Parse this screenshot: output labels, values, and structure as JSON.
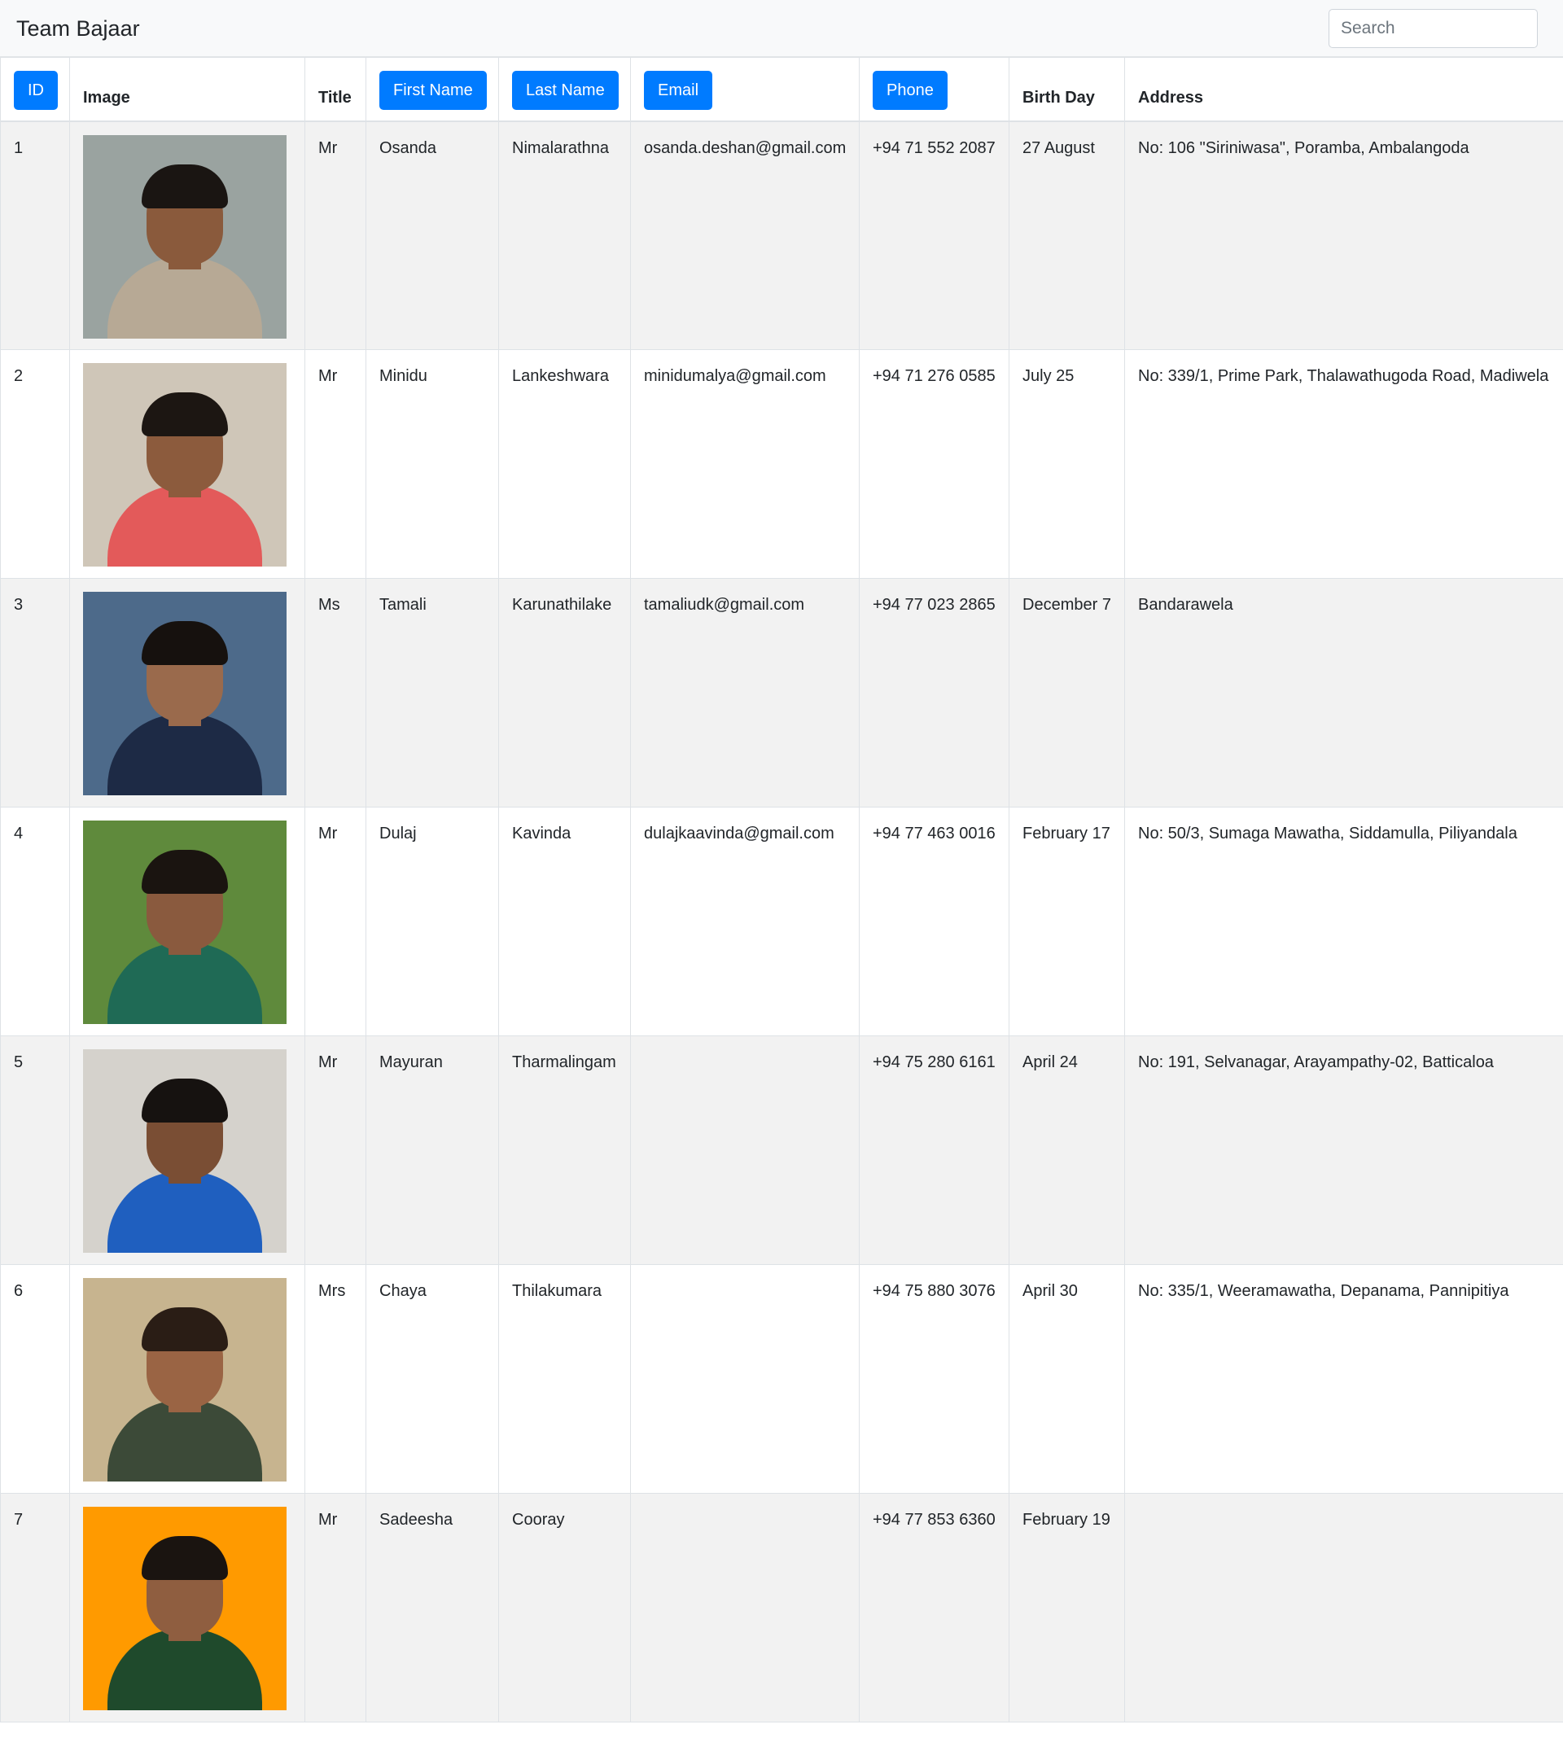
{
  "navbar": {
    "brand": "Team Bajaar",
    "search_placeholder": "Search"
  },
  "table": {
    "headers": {
      "id": "ID",
      "image": "Image",
      "title": "Title",
      "first_name": "First Name",
      "last_name": "Last Name",
      "email": "Email",
      "phone": "Phone",
      "birth_day": "Birth Day",
      "address": "Address"
    },
    "rows": [
      {
        "id": "1",
        "title": "Mr",
        "first_name": "Osanda",
        "last_name": "Nimalarathna",
        "email": "osanda.deshan@gmail.com",
        "phone": "+94 71 552 2087",
        "birth_day": "27 August",
        "address": "No: 106 \"Siriniwasa\", Poramba, Ambalangoda"
      },
      {
        "id": "2",
        "title": "Mr",
        "first_name": "Minidu",
        "last_name": "Lankeshwara",
        "email": "minidumalya@gmail.com",
        "phone": "+94 71 276 0585",
        "birth_day": "July 25",
        "address": "No: 339/1, Prime Park, Thalawathugoda Road, Madiwela"
      },
      {
        "id": "3",
        "title": "Ms",
        "first_name": "Tamali",
        "last_name": "Karunathilake",
        "email": "tamaliudk@gmail.com",
        "phone": "+94 77 023 2865",
        "birth_day": "December 7",
        "address": "Bandarawela"
      },
      {
        "id": "4",
        "title": "Mr",
        "first_name": "Dulaj",
        "last_name": "Kavinda",
        "email": "dulajkaavinda@gmail.com",
        "phone": "+94 77 463 0016",
        "birth_day": "February 17",
        "address": "No: 50/3, Sumaga Mawatha, Siddamulla, Piliyandala"
      },
      {
        "id": "5",
        "title": "Mr",
        "first_name": "Mayuran",
        "last_name": "Tharmalingam",
        "email": "",
        "phone": "+94 75 280 6161",
        "birth_day": "April 24",
        "address": "No: 191, Selvanagar, Arayampathy-02, Batticaloa"
      },
      {
        "id": "6",
        "title": "Mrs",
        "first_name": "Chaya",
        "last_name": "Thilakumara",
        "email": "",
        "phone": "+94 75 880 3076",
        "birth_day": "April 30",
        "address": "No: 335/1, Weeramawatha, Depanama, Pannipitiya"
      },
      {
        "id": "7",
        "title": "Mr",
        "first_name": "Sadeesha",
        "last_name": "Cooray",
        "email": "",
        "phone": "+94 77 853 6360",
        "birth_day": "February 19",
        "address": ""
      }
    ]
  },
  "photos": [
    {
      "bg": "#9aa3a0",
      "shirt": "#b7a995",
      "skin": "#8a5a3c",
      "hair": "#1a1512"
    },
    {
      "bg": "#cfc6b8",
      "shirt": "#e35a5a",
      "skin": "#8c5b3d",
      "hair": "#1c1612"
    },
    {
      "bg": "#4d6a8a",
      "shirt": "#1d2a45",
      "skin": "#9a6a4c",
      "hair": "#16110e"
    },
    {
      "bg": "#5f8a3c",
      "shirt": "#1f6a55",
      "skin": "#8a5a3e",
      "hair": "#1a1410"
    },
    {
      "bg": "#d5d2cc",
      "shirt": "#1f5fbf",
      "skin": "#7a4e34",
      "hair": "#161210"
    },
    {
      "bg": "#c7b48f",
      "shirt": "#3c4a38",
      "skin": "#9a6444",
      "hair": "#2a1d15"
    },
    {
      "bg": "#ff9a00",
      "shirt": "#1f4a2c",
      "skin": "#8f5e40",
      "hair": "#1a1410"
    }
  ]
}
